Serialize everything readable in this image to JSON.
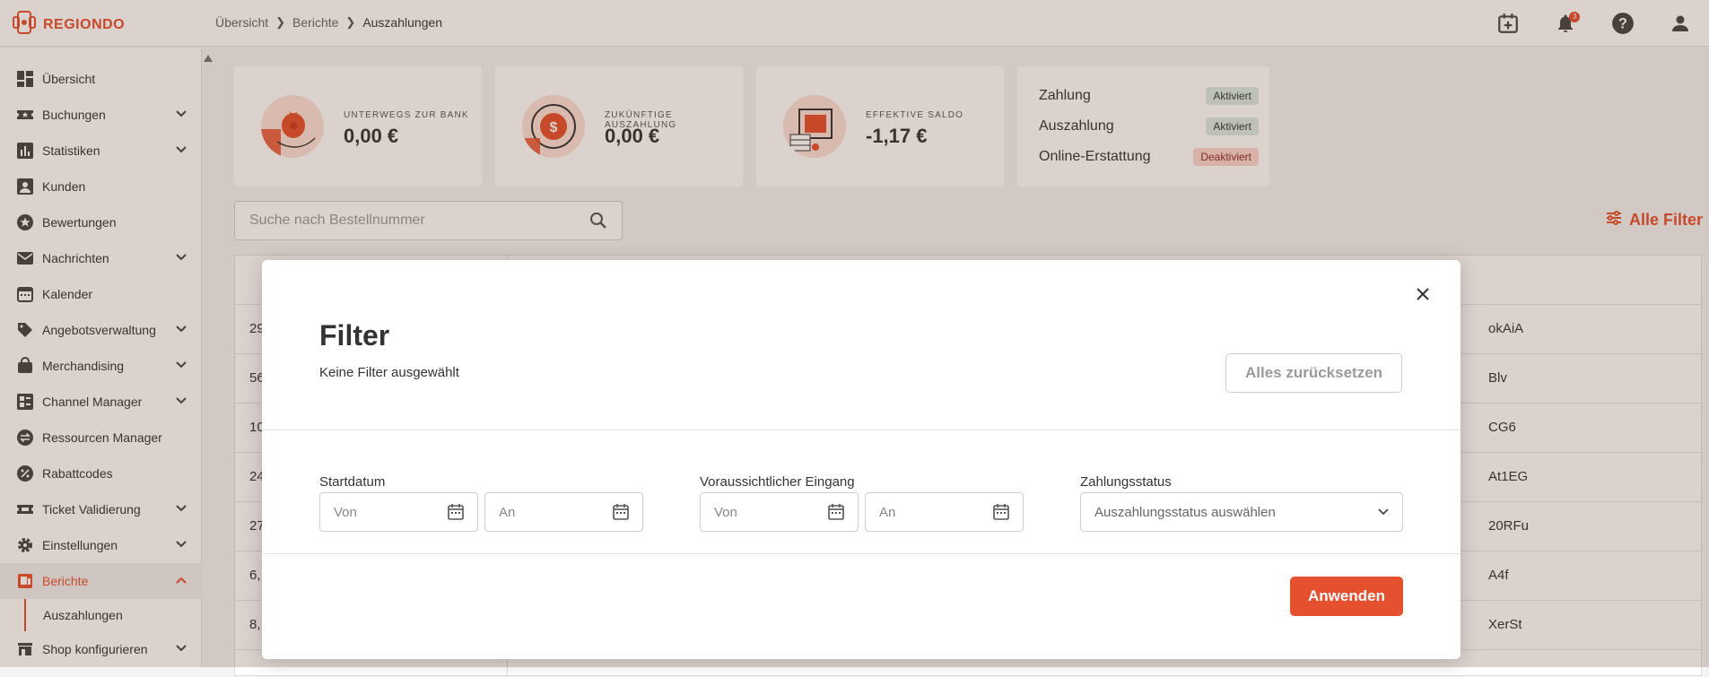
{
  "brand": {
    "name": "REGIONDO",
    "accent": "#e5502e"
  },
  "breadcrumb": [
    "Übersicht",
    "Berichte",
    "Auszahlungen"
  ],
  "header": {
    "notification_count": "3"
  },
  "sidebar": {
    "items": [
      {
        "label": "Übersicht",
        "icon": "dashboard-icon",
        "expandable": false
      },
      {
        "label": "Buchungen",
        "icon": "ticket-star-icon",
        "expandable": true
      },
      {
        "label": "Statistiken",
        "icon": "bar-chart-icon",
        "expandable": true
      },
      {
        "label": "Kunden",
        "icon": "person-icon",
        "expandable": false
      },
      {
        "label": "Bewertungen",
        "icon": "star-icon",
        "expandable": false
      },
      {
        "label": "Nachrichten",
        "icon": "mail-icon",
        "expandable": true
      },
      {
        "label": "Kalender",
        "icon": "calendar-icon",
        "expandable": false
      },
      {
        "label": "Angebotsverwaltung",
        "icon": "tag-icon",
        "expandable": true
      },
      {
        "label": "Merchandising",
        "icon": "shopping-bag-icon",
        "expandable": true
      },
      {
        "label": "Channel Manager",
        "icon": "channel-icon",
        "expandable": true
      },
      {
        "label": "Ressourcen Manager",
        "icon": "swap-icon",
        "expandable": false
      },
      {
        "label": "Rabattcodes",
        "icon": "percent-icon",
        "expandable": false
      },
      {
        "label": "Ticket Validierung",
        "icon": "ticket-icon",
        "expandable": true
      },
      {
        "label": "Einstellungen",
        "icon": "gear-icon",
        "expandable": true
      },
      {
        "label": "Berichte",
        "icon": "report-icon",
        "expandable": true
      }
    ],
    "sub_item": "Auszahlungen",
    "shop": "Shop konfigurieren"
  },
  "stats": [
    {
      "label": "UNTERWEGS ZUR BANK",
      "value": "0,00 €"
    },
    {
      "label": "ZUKÜNFTIGE AUSZAHLUNG",
      "value": "0,00 €"
    },
    {
      "label": "EFFEKTIVE SALDO",
      "value": "-1,17 €"
    }
  ],
  "status": [
    {
      "label": "Zahlung",
      "state": "Aktiviert"
    },
    {
      "label": "Auszahlung",
      "state": "Aktiviert"
    },
    {
      "label": "Online-Erstattung",
      "state": "Deaktiviert"
    }
  ],
  "search": {
    "placeholder": "Suche nach Bestellnummer"
  },
  "all_filter": "Alle Filter",
  "table": {
    "rows": [
      {
        "left": "29",
        "right": "okAiA"
      },
      {
        "left": "56",
        "right": "Blv"
      },
      {
        "left": "10",
        "right": "CG6"
      },
      {
        "left": "24",
        "right": "At1EG"
      },
      {
        "left": "27",
        "right": "20RFu"
      },
      {
        "left": "6,",
        "right": "A4f"
      },
      {
        "left": "8,",
        "right": "XerSt"
      }
    ]
  },
  "modal": {
    "title": "Filter",
    "subtitle": "Keine Filter ausgewählt",
    "reset": "Alles zurücksetzen",
    "startdatum": "Startdatum",
    "eingang": "Voraussichtlicher Eingang",
    "zahlungsstatus": "Zahlungsstatus",
    "von": "Von",
    "an": "An",
    "status_placeholder": "Auszahlungsstatus auswählen",
    "apply": "Anwenden"
  }
}
